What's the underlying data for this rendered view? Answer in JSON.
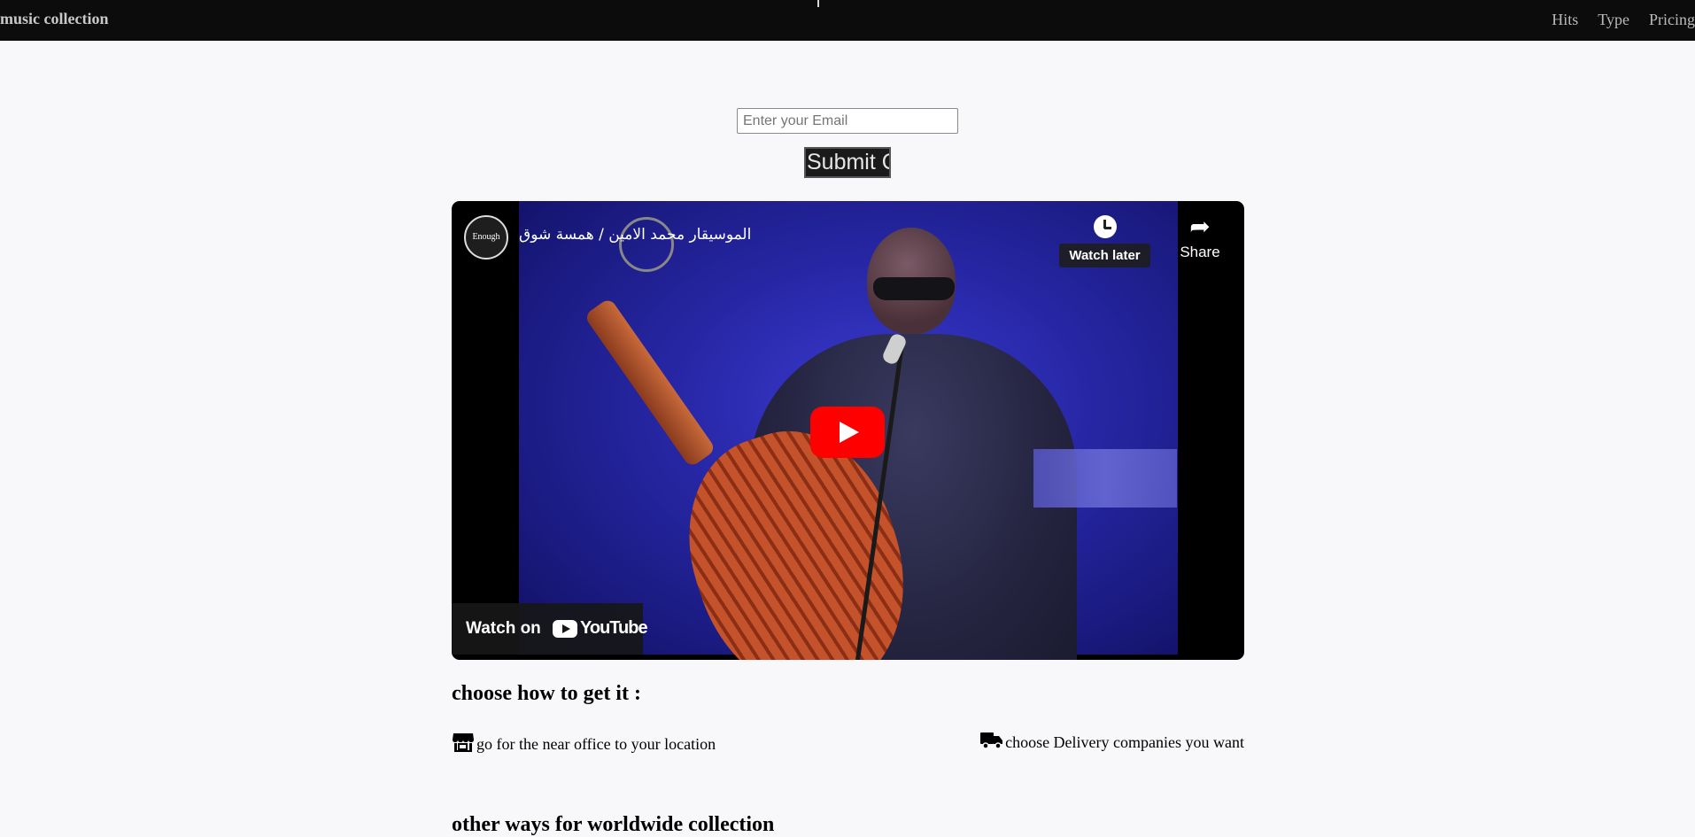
{
  "navbar": {
    "brand": "music collection",
    "links": [
      {
        "label": "Hits"
      },
      {
        "label": "Type"
      },
      {
        "label": "Pricing"
      }
    ]
  },
  "signup": {
    "email_placeholder": "Enter your Email",
    "submit_label": "Submit Q"
  },
  "video": {
    "channel_avatar_text": "Enough",
    "title": "الموسيقار محمد الامين / همسة شوق",
    "watch_later_label": "Watch later",
    "share_label": "Share",
    "watch_on_label": "Watch on",
    "youtube_label": "YouTube",
    "icons": [
      "clock-icon",
      "share-arrow-icon",
      "play-icon",
      "youtube-logo-icon"
    ]
  },
  "delivery": {
    "heading": "choose how to get it :",
    "options": [
      {
        "icon": "store-icon",
        "label": "go for the near office to your location"
      },
      {
        "icon": "truck-icon",
        "label": "choose Delivery companies you want"
      }
    ]
  },
  "next_section": {
    "heading": "other ways for worldwide collection"
  },
  "colors": {
    "navbar_bg": "#0d0c0d",
    "page_bg": "#f8f8fa",
    "youtube_red": "#ff0000"
  }
}
